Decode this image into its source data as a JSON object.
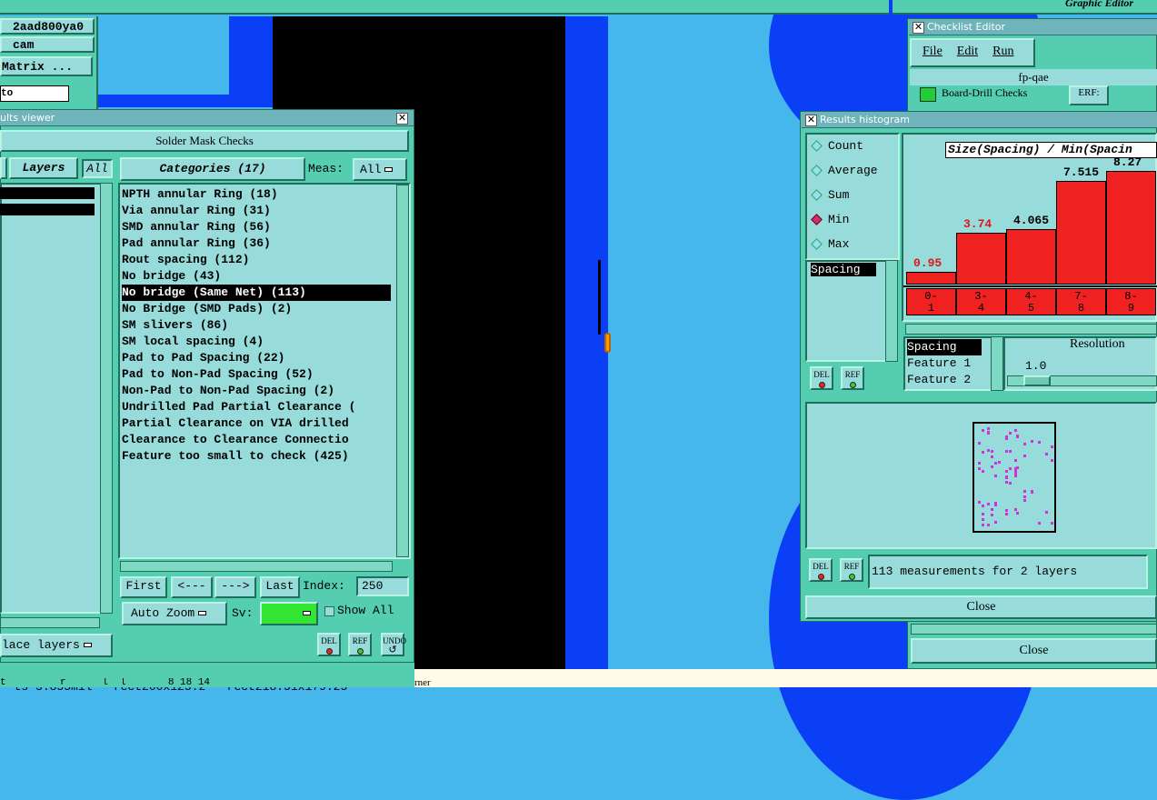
{
  "top_bar": {
    "graphic_editor_label": "Graphic Editor"
  },
  "left_top": {
    "field1": "2aad800ya0",
    "field2": "cam",
    "matrix_button": "Matrix ...",
    "field3": "to"
  },
  "results_viewer": {
    "title": "ults viewer",
    "header": "Solder Mask Checks",
    "layers_tab": "Layers",
    "all_tab": "All",
    "categories_tab": "Categories (17)",
    "meas_label": "Meas:",
    "meas_value": "All",
    "categories": [
      "NPTH annular Ring (18)",
      "Via annular Ring (31)",
      "SMD annular Ring (56)",
      "Pad annular Ring (36)",
      "Rout spacing (112)",
      "No bridge (43)",
      "No bridge (Same Net) (113)",
      "No Bridge (SMD Pads) (2)",
      "SM slivers (86)",
      "SM local spacing (4)",
      "Pad to Pad Spacing (22)",
      "Pad to Non-Pad Spacing (52)",
      "Non-Pad to Non-Pad Spacing (2)",
      "Undrilled Pad Partial Clearance (",
      "Partial Clearance on VIA drilled",
      "Clearance to Clearance Connectio",
      "Feature too small to check (425)"
    ],
    "selected_category_index": 6,
    "nav": {
      "first": "First",
      "prev": "<---",
      "next": "--->",
      "last": "Last",
      "index_label": "Index:",
      "index_value": "250"
    },
    "auto_zoom": "Auto Zoom",
    "sv_label": "Sv:",
    "show_all": "Show All",
    "place_layers": "lace layers",
    "del": "DEL",
    "ref": "REF",
    "undo": "UNDO"
  },
  "status_bar": {
    "text": "ts 3.855mil   rect200x125.2   rect218.51x179.25",
    "text2": "rner",
    "text3": "t         r      l  l       8 18 14"
  },
  "checklist_editor": {
    "title": "Checklist Editor",
    "menu": [
      "File",
      "Edit",
      "Run"
    ],
    "name": "fp-qae",
    "row_label": "Board-Drill Checks",
    "row_tag": "ERF:",
    "close": "Close"
  },
  "histogram": {
    "title": "Results histogram",
    "modes": [
      "Count",
      "Average",
      "Sum",
      "Min",
      "Max"
    ],
    "selected_mode": "Min",
    "left_list": [
      "Spacing"
    ],
    "chart_title": "Size(Spacing) / Min(Spacin",
    "right_list": [
      "Spacing",
      "Feature 1",
      "Feature 2"
    ],
    "resolution_label": "Resolution",
    "resolution_value": "1.0",
    "status": "113 measurements for 2 layers",
    "close": "Close",
    "del": "DEL",
    "ref": "REF"
  },
  "chart_data": {
    "type": "bar",
    "title": "Size(Spacing) / Min(Spacin",
    "categories": [
      "0-\n1",
      "3-\n4",
      "4-\n5",
      "7-\n8",
      "8-\n9"
    ],
    "values": [
      0.95,
      3.74,
      4.065,
      7.515,
      8.27
    ],
    "value_labels": [
      "0.95",
      "3.74",
      "4.065",
      "7.515",
      "8.27"
    ],
    "highlight_color": "#e01515",
    "bar_color": "#f02121"
  },
  "colors": {
    "panel": "#54cdb0",
    "canvas_blue": "#46b7ec",
    "dark_blue": "#0a3ff5",
    "black": "#000000",
    "green": "#33e533"
  }
}
